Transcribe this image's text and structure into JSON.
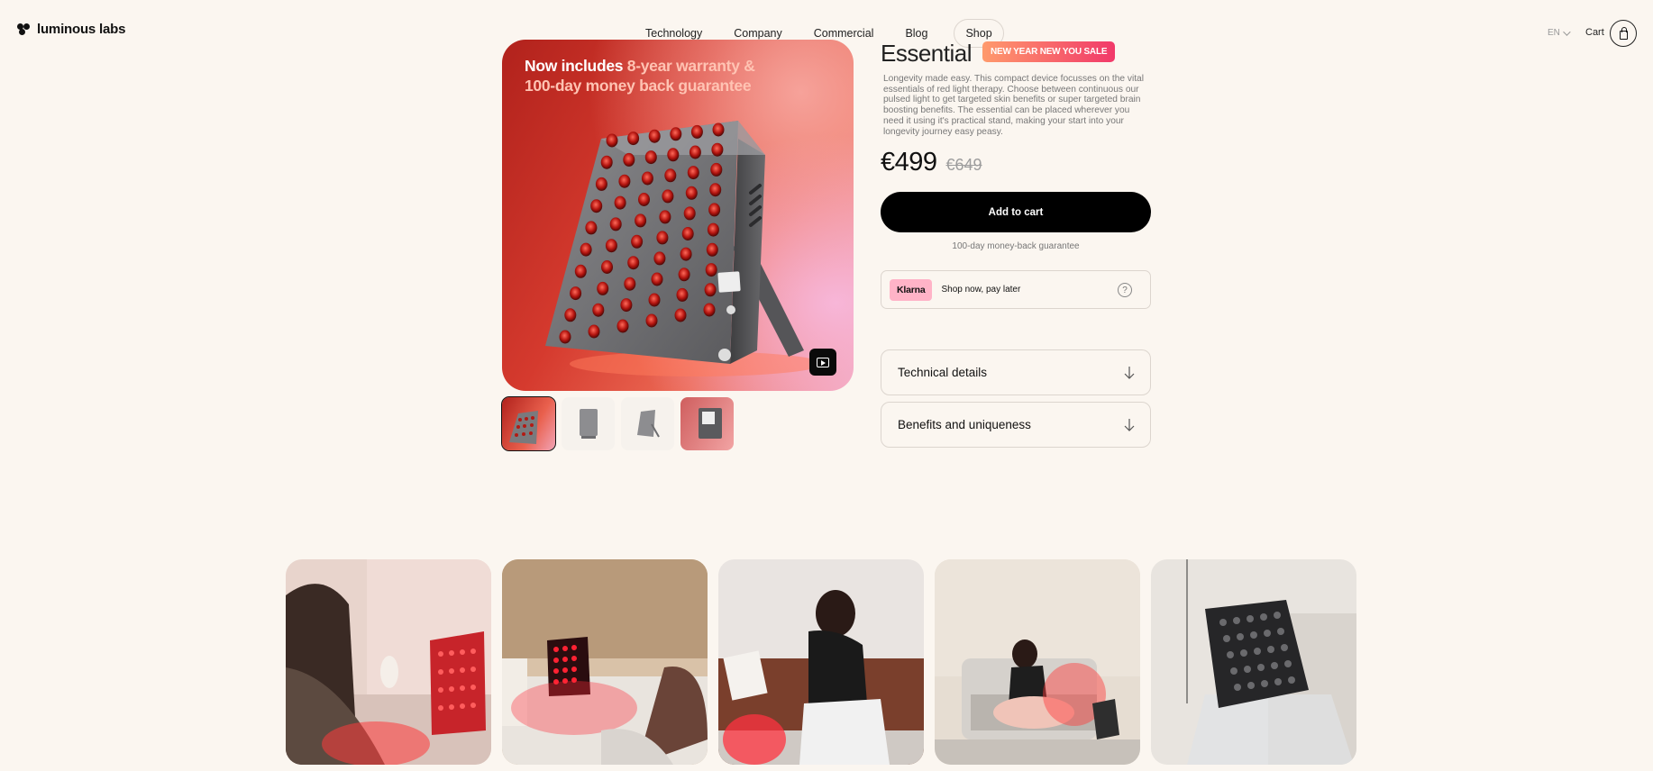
{
  "brand": {
    "name": "luminous labs"
  },
  "nav": {
    "items": [
      "Technology",
      "Company",
      "Commercial",
      "Blog"
    ],
    "shop": "Shop"
  },
  "header": {
    "language": "EN",
    "cart_label": "Cart"
  },
  "gallery": {
    "promo_line1": "Now includes ",
    "promo_highlight": "8-year warranty &",
    "promo_line2": "100-day money back guarantee",
    "thumbnail_count": 4,
    "active_thumbnail": 1
  },
  "product": {
    "title": "Essential",
    "badge": "NEW YEAR NEW YOU SALE",
    "description": "Longevity made easy. This compact device focusses on the vital essentials of red light therapy. Choose between continuous our pulsed light to get targeted skin benefits or super targeted brain boosting benefits. The essential can be placed wherever you need it using it's practical stand, making your start into your longevity journey easy peasy.",
    "price": "€499",
    "old_price": "€649",
    "add_to_cart": "Add to cart",
    "guarantee": "100-day money-back guarantee"
  },
  "klarna": {
    "logo": "Klarna",
    "text": "Shop now, pay later",
    "help": "?"
  },
  "accordions": [
    "Technical details",
    "Benefits and uniqueness"
  ],
  "colors": {
    "background": "#fbf6f0",
    "primary_button": "#000000",
    "badge_start": "#ff9a6c",
    "badge_end": "#f1396a",
    "klarna_pink": "#ffb3c7",
    "device_red": "#c41e1e"
  }
}
